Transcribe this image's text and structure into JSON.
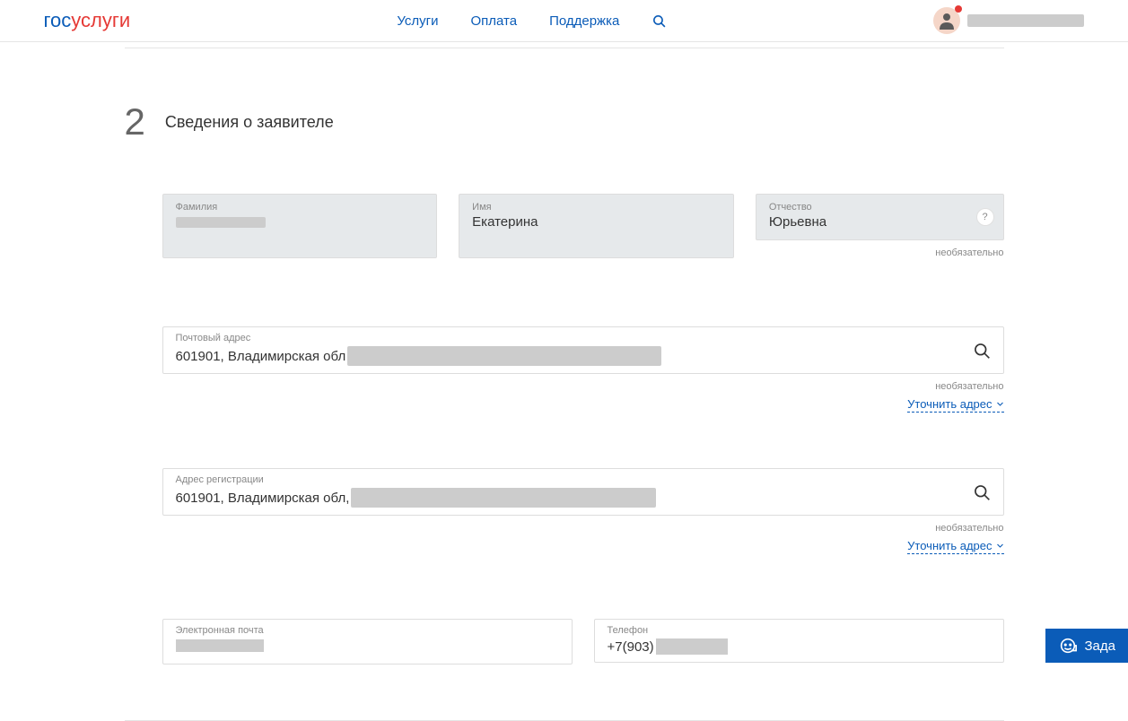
{
  "header": {
    "logo_part1": "гос",
    "logo_part2": "услуги",
    "nav": {
      "services": "Услуги",
      "payment": "Оплата",
      "support": "Поддержка"
    }
  },
  "step": {
    "number": "2",
    "title": "Сведения о заявителе"
  },
  "name_fields": {
    "surname": {
      "label": "Фамилия"
    },
    "name": {
      "label": "Имя",
      "value": "Екатерина"
    },
    "patronymic": {
      "label": "Отчество",
      "value": "Юрьевна",
      "optional": "необязательно"
    }
  },
  "postal_address": {
    "label": "Почтовый адрес",
    "value_visible": "601901, Владимирская обл",
    "optional": "необязательно",
    "refine": "Уточнить адрес"
  },
  "reg_address": {
    "label": "Адрес регистрации",
    "value_visible": "601901, Владимирская обл,",
    "optional": "необязательно",
    "refine": "Уточнить адрес"
  },
  "email": {
    "label": "Электронная почта"
  },
  "phone": {
    "label": "Телефон",
    "value_visible": "+7(903)"
  },
  "chat": {
    "label": "Зада"
  },
  "help_tooltip": "?"
}
